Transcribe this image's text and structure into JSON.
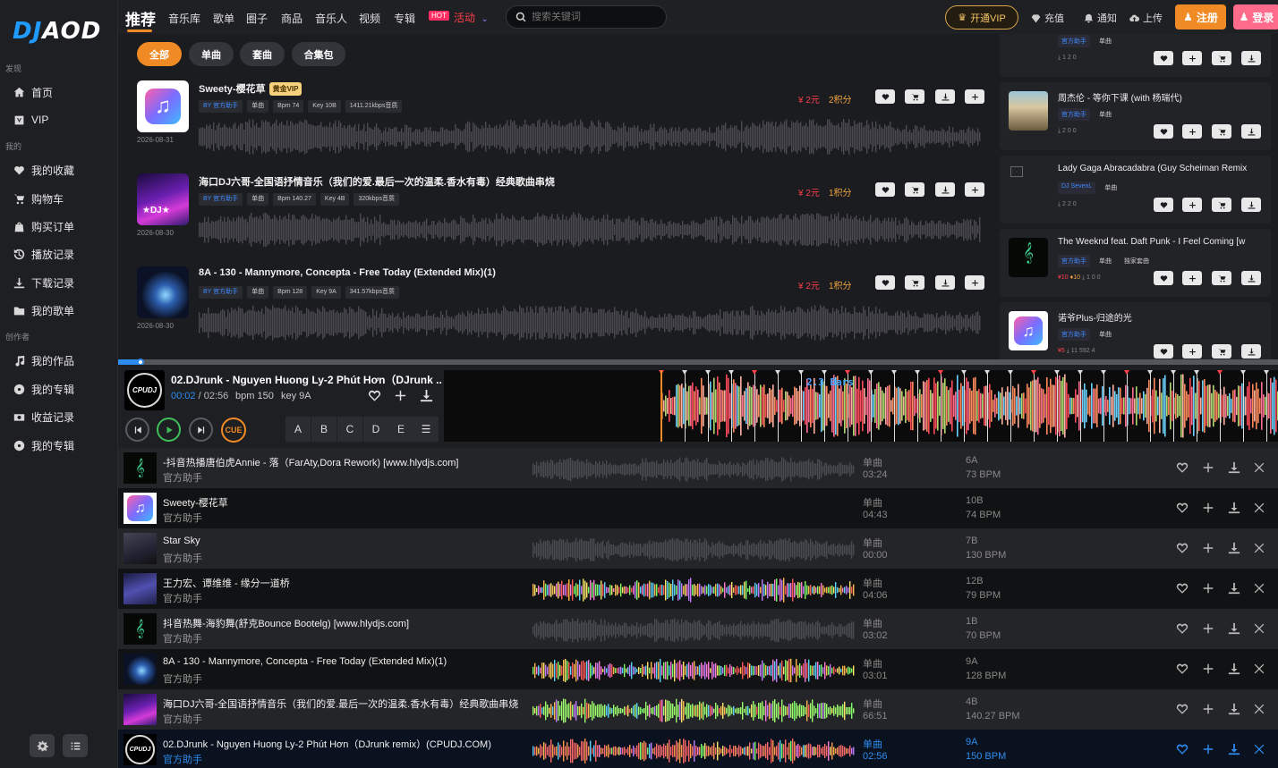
{
  "logo": {
    "part1": "DJ",
    "part2": "AOD"
  },
  "sidebar": {
    "sections": [
      "发现",
      "我的",
      "创作者"
    ],
    "discover": [
      {
        "label": "首页",
        "icon": "home-icon"
      },
      {
        "label": "VIP",
        "icon": "vip-icon"
      }
    ],
    "mine": [
      {
        "label": "我的收藏",
        "icon": "heart-icon"
      },
      {
        "label": "购物车",
        "icon": "cart-icon"
      },
      {
        "label": "购买订单",
        "icon": "bag-icon"
      },
      {
        "label": "播放记录",
        "icon": "history-icon"
      },
      {
        "label": "下载记录",
        "icon": "download-icon"
      },
      {
        "label": "我的歌单",
        "icon": "folder-icon"
      }
    ],
    "creator": [
      {
        "label": "我的作品",
        "icon": "music-note-icon"
      },
      {
        "label": "我的专辑",
        "icon": "disc-icon"
      },
      {
        "label": "收益记录",
        "icon": "money-icon"
      },
      {
        "label": "我的专辑",
        "icon": "disc-icon"
      }
    ]
  },
  "header": {
    "title": "推荐",
    "nav": [
      "音乐库",
      "歌单",
      "圈子",
      "商品",
      "音乐人",
      "视频",
      "专辑"
    ],
    "hot_badge": "HOT",
    "activity": "活动",
    "search_placeholder": "搜索关键词",
    "vip_button": "开通VIP",
    "recharge": "充值",
    "notify": "通知",
    "upload": "上传",
    "register": "注册",
    "login": "登录"
  },
  "filters": [
    "全部",
    "单曲",
    "套曲",
    "合集包"
  ],
  "tracks": [
    {
      "title": "Sweety-樱花草",
      "vip": "黄金VIP",
      "tags": [
        "BY 官方助手",
        "单曲",
        "Bpm 74",
        "Key 10B",
        "1411.21kbps音质"
      ],
      "date": "2026-08-31",
      "price": "¥ 2元",
      "points": "2积分"
    },
    {
      "title": "海口DJ六哥-全国语抒情音乐（我们的爱.最后一次的温柔.香水有毒）经典歌曲串烧",
      "vip": "",
      "tags": [
        "BY 官方助手",
        "单曲",
        "Bpm 140.27",
        "Key 4B",
        "320kbps音质"
      ],
      "date": "2026-08-30",
      "price": "¥ 2元",
      "points": "1积分"
    },
    {
      "title": "8A - 130 - Mannymore, Concepta - Free Today (Extended Mix)(1)",
      "vip": "",
      "tags": [
        "BY 官方助手",
        "单曲",
        "Bpm 128",
        "Key 9A",
        "341.57kbps音质"
      ],
      "date": "2026-08-30",
      "price": "¥ 2元",
      "points": "1积分"
    }
  ],
  "right_list": [
    {
      "title": "",
      "tags": [
        "官方助手",
        "单曲"
      ],
      "stats": "1  2  0",
      "price": "",
      "pts": ""
    },
    {
      "title": "周杰伦 - 等你下课 (with 杨瑞代)",
      "tags": [
        "官方助手",
        "单曲"
      ],
      "stats": "2  0  0",
      "price": "",
      "pts": ""
    },
    {
      "title": "Lady Gaga Abracadabra (Guy Scheiman Remix",
      "tags": [
        "DJ SevenL",
        "单曲"
      ],
      "stats": "2  2  0",
      "price": "",
      "pts": ""
    },
    {
      "title": "The Weeknd feat. Daft Punk - I Feel Coming [w",
      "tags": [
        "官方助手",
        "单曲",
        "独家套曲"
      ],
      "stats": "1  0  0",
      "price": "¥10",
      "pts": "10"
    },
    {
      "title": "诺爷Plus-归途的光",
      "tags": [
        "官方助手",
        "单曲"
      ],
      "stats": "11  592  4",
      "price": "¥5",
      "pts": ""
    }
  ],
  "player": {
    "title": "02.DJrunk - Nguyen Huong Ly-2 Phút Hơn（DJrunk ...",
    "current": "00:02",
    "total": "02:56",
    "bpm": "bpm 150",
    "key": "key 9A",
    "progress": 0.019,
    "cue": "CUE",
    "hotcues": [
      "A",
      "B",
      "C",
      "D",
      "E"
    ],
    "bars_label": "2.3 Bars"
  },
  "queue": [
    {
      "title": "-抖音热播唐伯虎Annie - 落（FarAty,Dora Rework) [www.hlydjs.com]",
      "artist": "官方助手",
      "type": "单曲",
      "dur": "03:24",
      "key": "6A",
      "bpm": "73 BPM",
      "wave": "gray"
    },
    {
      "title": "Sweety-樱花草",
      "artist": "官方助手",
      "type": "单曲",
      "dur": "04:43",
      "key": "10B",
      "bpm": "74 BPM",
      "wave": "none"
    },
    {
      "title": "Star Sky",
      "artist": "官方助手",
      "type": "单曲",
      "dur": "00:00",
      "key": "7B",
      "bpm": "130 BPM",
      "wave": "gray"
    },
    {
      "title": "王力宏、谭维维 - 缘分一道桥",
      "artist": "官方助手",
      "type": "单曲",
      "dur": "04:06",
      "key": "12B",
      "bpm": "79 BPM",
      "wave": "color"
    },
    {
      "title": "抖音热舞-海豹舞(舒克Bounce Bootelg) [www.hlydjs.com]",
      "artist": "官方助手",
      "type": "单曲",
      "dur": "03:02",
      "key": "1B",
      "bpm": "70 BPM",
      "wave": "gray"
    },
    {
      "title": "8A - 130 - Mannymore, Concepta - Free Today (Extended Mix)(1)",
      "artist": "官方助手",
      "type": "单曲",
      "dur": "03:01",
      "key": "9A",
      "bpm": "128 BPM",
      "wave": "color"
    },
    {
      "title": "海口DJ六哥-全国语抒情音乐（我们的爱.最后一次的温柔.香水有毒）经典歌曲串烧",
      "artist": "官方助手",
      "type": "单曲",
      "dur": "66:51",
      "key": "4B",
      "bpm": "140.27 BPM",
      "wave": "green"
    },
    {
      "title": "02.DJrunk - Nguyen Huong Ly-2 Phút Hơn（DJrunk remix）(CPUDJ.COM)",
      "artist": "官方助手",
      "type": "单曲",
      "dur": "02:56",
      "key": "9A",
      "bpm": "150 BPM",
      "wave": "red"
    }
  ]
}
